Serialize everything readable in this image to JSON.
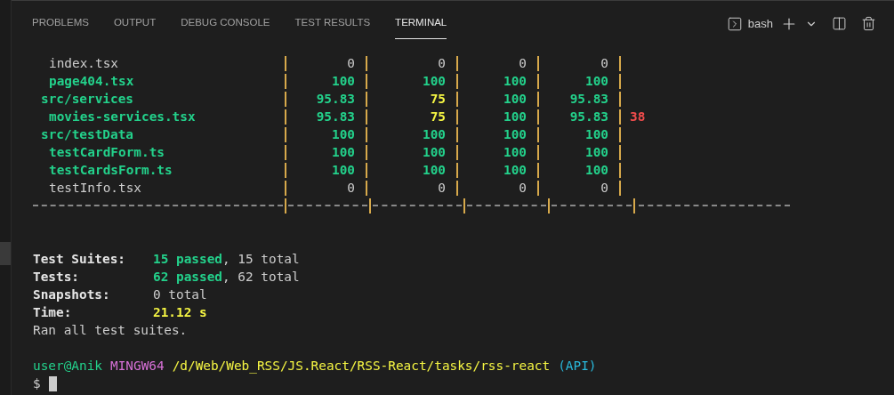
{
  "panel_tabs": [
    {
      "label": "PROBLEMS",
      "selected": false
    },
    {
      "label": "OUTPUT",
      "selected": false
    },
    {
      "label": "DEBUG CONSOLE",
      "selected": false
    },
    {
      "label": "TEST RESULTS",
      "selected": false
    },
    {
      "label": "TERMINAL",
      "selected": true
    }
  ],
  "terminal_selector": {
    "label": "bash"
  },
  "coverage_table": {
    "rows": [
      {
        "children": [
          {
            "name": "index.tsx",
            "kind": "none",
            "cells": [
              {
                "text": "0",
                "kind": "none"
              },
              {
                "text": "0",
                "kind": "none"
              },
              {
                "text": "0",
                "kind": "none"
              },
              {
                "text": "0",
                "kind": "none"
              }
            ]
          },
          {
            "name": "page404.tsx",
            "kind": "high",
            "cells": [
              {
                "text": "100",
                "kind": "high"
              },
              {
                "text": "100",
                "kind": "high"
              },
              {
                "text": "100",
                "kind": "high"
              },
              {
                "text": "100",
                "kind": "high"
              }
            ]
          }
        ]
      },
      {
        "name": "src/services",
        "kind": "high",
        "cells": [
          {
            "text": "95.83",
            "kind": "high"
          },
          {
            "text": "75",
            "kind": "medium"
          },
          {
            "text": "100",
            "kind": "high"
          },
          {
            "text": "95.83",
            "kind": "high"
          }
        ],
        "children": [
          {
            "name": "movies-services.tsx",
            "kind": "high",
            "cells": [
              {
                "text": "95.83",
                "kind": "high"
              },
              {
                "text": "75",
                "kind": "medium"
              },
              {
                "text": "100",
                "kind": "high"
              },
              {
                "text": "95.83",
                "kind": "high"
              }
            ],
            "uncovered": "38"
          }
        ]
      },
      {
        "name": "src/testData",
        "kind": "high",
        "cells": [
          {
            "text": "100",
            "kind": "high"
          },
          {
            "text": "100",
            "kind": "high"
          },
          {
            "text": "100",
            "kind": "high"
          },
          {
            "text": "100",
            "kind": "high"
          }
        ],
        "children": [
          {
            "name": "testCardForm.ts",
            "kind": "high",
            "cells": [
              {
                "text": "100",
                "kind": "high"
              },
              {
                "text": "100",
                "kind": "high"
              },
              {
                "text": "100",
                "kind": "high"
              },
              {
                "text": "100",
                "kind": "high"
              }
            ]
          },
          {
            "name": "testCardsForm.ts",
            "kind": "high",
            "cells": [
              {
                "text": "100",
                "kind": "high"
              },
              {
                "text": "100",
                "kind": "high"
              },
              {
                "text": "100",
                "kind": "high"
              },
              {
                "text": "100",
                "kind": "high"
              }
            ]
          },
          {
            "name": "testInfo.tsx",
            "kind": "none",
            "cells": [
              {
                "text": "0",
                "kind": "none"
              },
              {
                "text": "0",
                "kind": "none"
              },
              {
                "text": "0",
                "kind": "none"
              },
              {
                "text": "0",
                "kind": "none"
              }
            ]
          }
        ]
      }
    ]
  },
  "summary": [
    {
      "label": "Test Suites:",
      "parts": [
        {
          "text": "15 passed",
          "kind": "pass"
        },
        {
          "text": ", 15 total",
          "kind": "plain"
        }
      ]
    },
    {
      "label": "Tests:",
      "parts": [
        {
          "text": "62 passed",
          "kind": "pass"
        },
        {
          "text": ", 62 total",
          "kind": "plain"
        }
      ]
    },
    {
      "label": "Snapshots:",
      "parts": [
        {
          "text": "0 total",
          "kind": "plain"
        }
      ]
    },
    {
      "label": "Time:",
      "parts": [
        {
          "text": "21.12 s",
          "kind": "time"
        }
      ]
    }
  ],
  "summary_message": "Ran all test suites.",
  "prompt": {
    "user": "user@Anik",
    "system": "MINGW64",
    "path": "/d/Web/Web_RSS/JS.React/RSS-React/tasks/rss-react",
    "branch": "(API)",
    "symbol": "$"
  }
}
